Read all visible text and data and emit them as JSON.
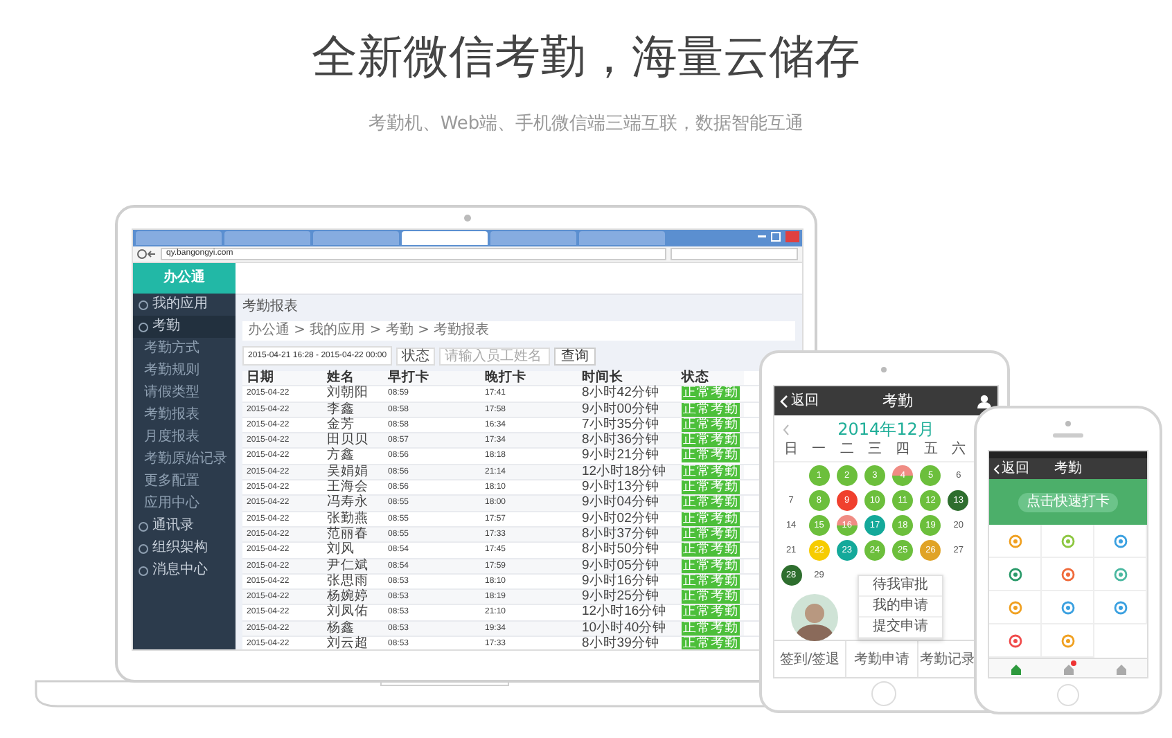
{
  "headline": "全新微信考勤，海量云储存",
  "subline": "考勤机、Web端、手机微信端三端互联，数据智能互通",
  "laptop": {
    "browser_tabs": [
      {
        "selected": false
      },
      {
        "selected": false
      },
      {
        "selected": false
      },
      {
        "selected": true
      },
      {
        "selected": false
      },
      {
        "selected": false
      }
    ],
    "address": "qy.bangongyi.com",
    "logo": "办公通",
    "nav": [
      {
        "label": "我的应用",
        "expanded": false
      },
      {
        "label": "考勤",
        "expanded": true,
        "children": [
          "考勤方式",
          "考勤规则",
          "请假类型",
          "考勤报表",
          "月度报表",
          "考勤原始记录",
          "更多配置",
          "应用中心"
        ]
      },
      {
        "label": "通讯录",
        "expanded": false
      },
      {
        "label": "组织架构",
        "expanded": false
      },
      {
        "label": "消息中心",
        "expanded": false
      }
    ],
    "page_title": "考勤报表",
    "breadcrumb": "办公通 > 我的应用 > 考勤 > 考勤报表",
    "filter": {
      "date_range": "2015-04-21 16:28 - 2015-04-22 00:00",
      "status": "状态",
      "placeholder": "请输入员工姓名",
      "button": "查询"
    },
    "table": {
      "columns": [
        "日期",
        "姓名",
        "早打卡",
        "晚打卡",
        "时间长",
        "状态"
      ],
      "rows": [
        [
          "2015-04-22",
          "刘朝阳",
          "08:59",
          "17:41",
          "8小时42分钟",
          "正常考勤"
        ],
        [
          "2015-04-22",
          "李鑫",
          "08:58",
          "17:58",
          "9小时00分钟",
          "正常考勤"
        ],
        [
          "2015-04-22",
          "金芳",
          "08:58",
          "16:34",
          "7小时35分钟",
          "正常考勤"
        ],
        [
          "2015-04-22",
          "田贝贝",
          "08:57",
          "17:34",
          "8小时36分钟",
          "正常考勤"
        ],
        [
          "2015-04-22",
          "方鑫",
          "08:56",
          "18:18",
          "9小时21分钟",
          "正常考勤"
        ],
        [
          "2015-04-22",
          "吴娟娟",
          "08:56",
          "21:14",
          "12小时18分钟",
          "正常考勤"
        ],
        [
          "2015-04-22",
          "王海会",
          "08:56",
          "18:10",
          "9小时13分钟",
          "正常考勤"
        ],
        [
          "2015-04-22",
          "冯寿永",
          "08:55",
          "18:00",
          "9小时04分钟",
          "正常考勤"
        ],
        [
          "2015-04-22",
          "张勤燕",
          "08:55",
          "17:57",
          "9小时02分钟",
          "正常考勤"
        ],
        [
          "2015-04-22",
          "范丽春",
          "08:55",
          "17:33",
          "8小时37分钟",
          "正常考勤"
        ],
        [
          "2015-04-22",
          "刘风",
          "08:54",
          "17:45",
          "8小时50分钟",
          "正常考勤"
        ],
        [
          "2015-04-22",
          "尹仁斌",
          "08:54",
          "17:59",
          "9小时05分钟",
          "正常考勤"
        ],
        [
          "2015-04-22",
          "张思雨",
          "08:53",
          "18:10",
          "9小时16分钟",
          "正常考勤"
        ],
        [
          "2015-04-22",
          "杨婉婷",
          "08:53",
          "18:19",
          "9小时25分钟",
          "正常考勤"
        ],
        [
          "2015-04-22",
          "刘凤佑",
          "08:53",
          "21:10",
          "12小时16分钟",
          "正常考勤"
        ],
        [
          "2015-04-22",
          "杨鑫",
          "08:53",
          "19:34",
          "10小时40分钟",
          "正常考勤"
        ],
        [
          "2015-04-22",
          "刘云超",
          "08:53",
          "17:33",
          "8小时39分钟",
          "正常考勤"
        ]
      ]
    }
  },
  "tablet": {
    "back": "返回",
    "title": "考勤",
    "month": "2014年12月",
    "weekdays": [
      "日",
      "一",
      "二",
      "三",
      "四",
      "五",
      "六"
    ],
    "weeks": [
      [
        {
          "kind": "empty"
        },
        {
          "day": "1",
          "kind": "dot",
          "color": "#6cbf3c"
        },
        {
          "day": "2",
          "kind": "dot",
          "color": "#6cbf3c"
        },
        {
          "day": "3",
          "kind": "dot",
          "color": "#6cbf3c"
        },
        {
          "day": "4",
          "kind": "split",
          "halves": [
            {
              "color": "#f08c84"
            },
            {
              "color": "#6cbf3c"
            }
          ]
        },
        {
          "day": "5",
          "kind": "dot",
          "color": "#6cbf3c"
        },
        {
          "day": "6",
          "kind": "plain"
        }
      ],
      [
        {
          "day": "7",
          "kind": "plain"
        },
        {
          "day": "8",
          "kind": "dot",
          "color": "#6cbf3c"
        },
        {
          "day": "9",
          "kind": "dot",
          "color": "#f0402e"
        },
        {
          "day": "10",
          "kind": "dot",
          "color": "#6cbf3c"
        },
        {
          "day": "11",
          "kind": "dot",
          "color": "#6cbf3c"
        },
        {
          "day": "12",
          "kind": "dot",
          "color": "#6cbf3c"
        },
        {
          "day": "13",
          "kind": "dot",
          "color": "#2e6e2e"
        }
      ],
      [
        {
          "day": "14",
          "kind": "plain"
        },
        {
          "day": "15",
          "kind": "dot",
          "color": "#6cbf3c"
        },
        {
          "day": "16",
          "kind": "split",
          "halves": [
            {
              "color": "#f08c84"
            },
            {
              "color": "#6cbf3c"
            }
          ]
        },
        {
          "day": "17",
          "kind": "dot",
          "color": "#14a99a"
        },
        {
          "day": "18",
          "kind": "dot",
          "color": "#6cbf3c"
        },
        {
          "day": "19",
          "kind": "dot",
          "color": "#6cbf3c"
        },
        {
          "day": "20",
          "kind": "plain"
        }
      ],
      [
        {
          "day": "21",
          "kind": "plain"
        },
        {
          "day": "22",
          "kind": "dot",
          "color": "#f6cc00"
        },
        {
          "day": "23",
          "kind": "dot",
          "color": "#14a99a"
        },
        {
          "day": "24",
          "kind": "dot",
          "color": "#6cbf3c"
        },
        {
          "day": "25",
          "kind": "dot",
          "color": "#6cbf3c"
        },
        {
          "day": "26",
          "kind": "dot",
          "color": "#e0a326"
        },
        {
          "day": "27",
          "kind": "plain"
        }
      ],
      [
        {
          "day": "28",
          "kind": "dot",
          "color": "#2e6e2e"
        },
        {
          "day": "29",
          "kind": "plain"
        }
      ]
    ],
    "menu": [
      "待我审批",
      "我的申请",
      "提交申请"
    ],
    "tabs": [
      "签到/签退",
      "考勤申请",
      "考勤记录"
    ]
  },
  "phone": {
    "back": "返回",
    "title": "考勤",
    "punch_button": "点击快速打卡",
    "apps": [
      {
        "color": "#f0a020"
      },
      {
        "color": "#8cc63f"
      },
      {
        "color": "#3aa0e0"
      },
      {
        "color": "#2a9a6a"
      },
      {
        "color": "#f06a3a"
      },
      {
        "color": "#4ab8a0"
      },
      {
        "color": "#f0a020"
      },
      {
        "color": "#3aa0e0"
      },
      {
        "color": "#3aa0e0"
      },
      {
        "color": "#f04a4a"
      },
      {
        "color": "#f0a020"
      }
    ],
    "nav": [
      {
        "selected": true,
        "alert": false
      },
      {
        "selected": false,
        "alert": true
      },
      {
        "selected": false,
        "alert": false
      }
    ]
  }
}
